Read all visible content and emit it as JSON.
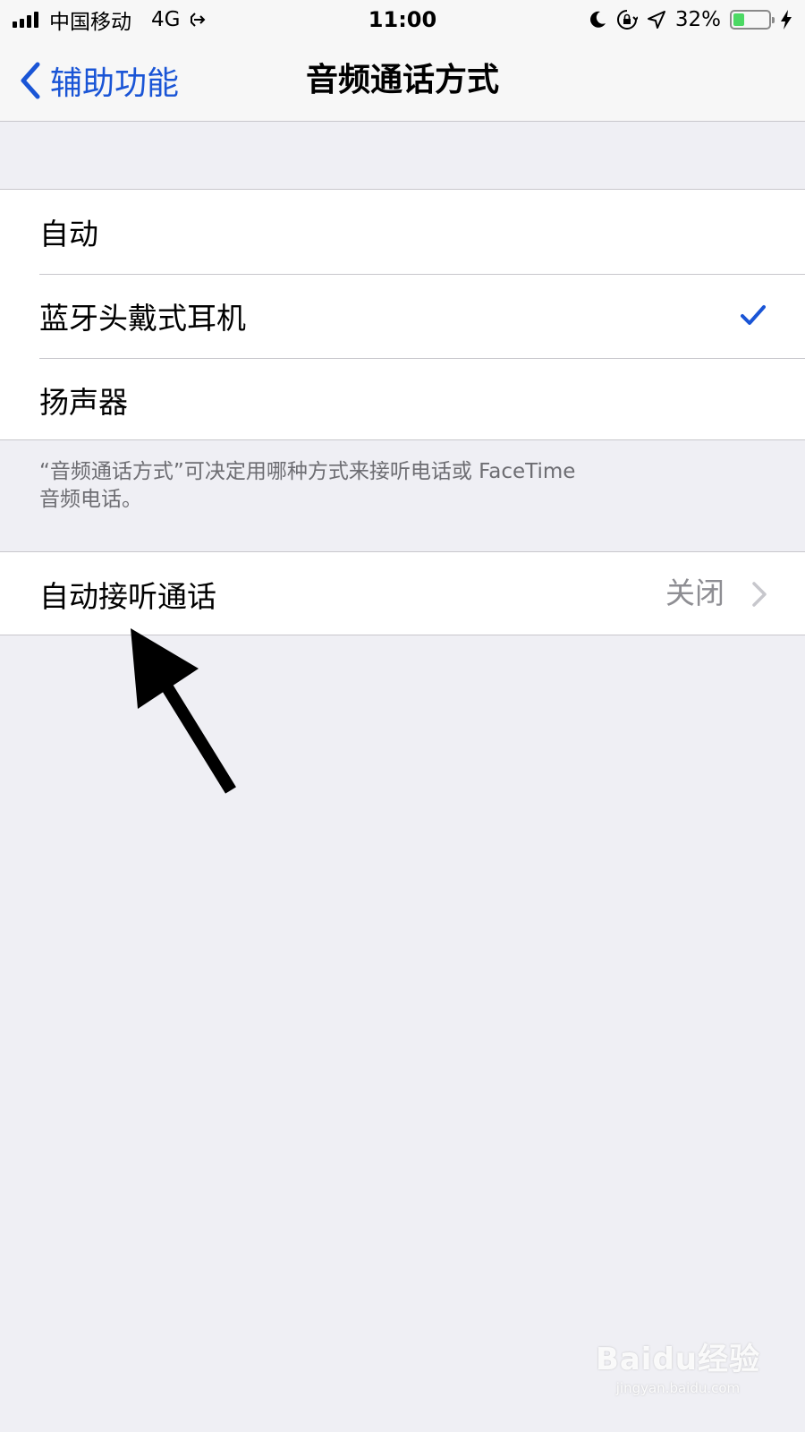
{
  "status_bar": {
    "carrier": "中国移动",
    "network": "4G",
    "time": "11:00",
    "battery_percent_text": "32%",
    "battery_level": 0.32,
    "icons": [
      "signal-icon",
      "vpn-arrow-icon",
      "moon-icon",
      "rotation-lock-icon",
      "location-icon",
      "battery-icon",
      "charging-bolt-icon"
    ]
  },
  "nav": {
    "back_label": "辅助功能",
    "title": "音频通话方式"
  },
  "audio_routing": {
    "options": [
      {
        "label": "自动",
        "selected": false
      },
      {
        "label": "蓝牙头戴式耳机",
        "selected": true
      },
      {
        "label": "扬声器",
        "selected": false
      }
    ],
    "footer_line1": "“音频通话方式”可决定用哪种方式来接听电话或 FaceTime",
    "footer_line2": "音频电话。"
  },
  "auto_answer": {
    "label": "自动接听通话",
    "value": "关闭"
  },
  "watermark": {
    "brand": "Baidu经验",
    "url": "jingyan.baidu.com"
  },
  "colors": {
    "accent": "#1a55d6",
    "background": "#efeff4",
    "battery": "#4cd964"
  }
}
